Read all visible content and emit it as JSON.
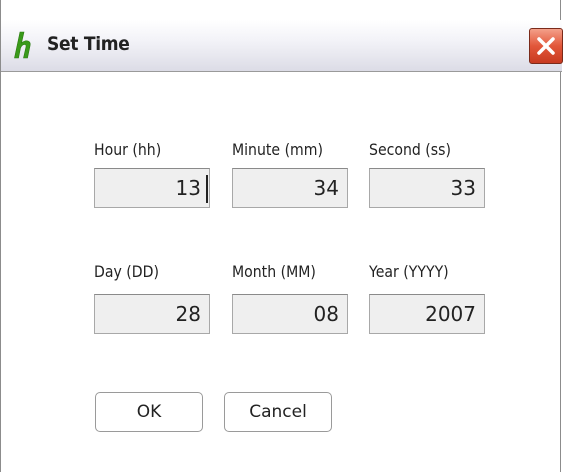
{
  "dialog": {
    "title": "Set Time",
    "icon": "h-logo-icon",
    "close_icon": "close-x-icon",
    "accent_color": "#3a9a1a",
    "close_color": "#e2573a"
  },
  "time_fields": [
    {
      "label": "Hour (hh)",
      "value": "13"
    },
    {
      "label": "Minute (mm)",
      "value": "34"
    },
    {
      "label": "Second (ss)",
      "value": "33"
    }
  ],
  "date_fields": [
    {
      "label": "Day (DD)",
      "value": "28"
    },
    {
      "label": "Month (MM)",
      "value": "08"
    },
    {
      "label": "Year (YYYY)",
      "value": "2007"
    }
  ],
  "buttons": {
    "ok": "OK",
    "cancel": "Cancel"
  }
}
